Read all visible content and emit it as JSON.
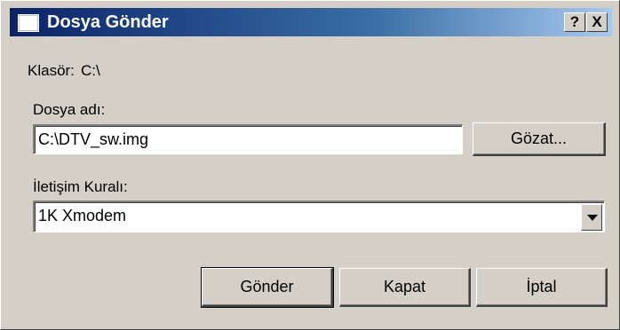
{
  "window": {
    "title": "Dosya Gönder",
    "help_label": "?",
    "close_label": "X"
  },
  "folder": {
    "label": "Klasör:",
    "value": "C:\\"
  },
  "filename": {
    "label": "Dosya adı:",
    "value": "C:\\DTV_sw.img",
    "browse_label": "Gözat..."
  },
  "protocol": {
    "label": "İletişim Kuralı:",
    "selected": "1K Xmodem"
  },
  "actions": {
    "send_label": "Gönder",
    "close_label": "Kapat",
    "cancel_label": "İptal"
  }
}
